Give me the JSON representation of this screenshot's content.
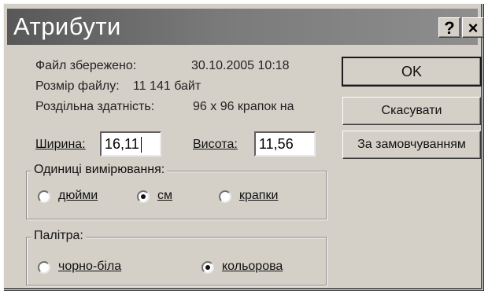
{
  "window": {
    "title": "Атрибути",
    "help_button": "?",
    "close_button": "×"
  },
  "info": {
    "saved_label": "Файл збережено:",
    "saved_value": "30.10.2005 10:18",
    "size_label": "Розмір файлу:",
    "size_value": "11 141 байт",
    "resolution_label": "Роздільна здатність:",
    "resolution_value": "96 x 96 крапок на"
  },
  "buttons": {
    "ok": "OK",
    "cancel": "Скасувати",
    "default": "За замовчуванням"
  },
  "dimensions": {
    "width_label": "Ширина:",
    "width_value": "16,11",
    "height_label": "Висота:",
    "height_value": "11,56"
  },
  "units": {
    "title": "Одиниці вимірювання:",
    "options": [
      "дюйми",
      "см",
      "крапки"
    ],
    "selected": "см"
  },
  "palette": {
    "title": "Палітра:",
    "options": [
      "чорно-біла",
      "кольорова"
    ],
    "selected": "кольорова"
  }
}
